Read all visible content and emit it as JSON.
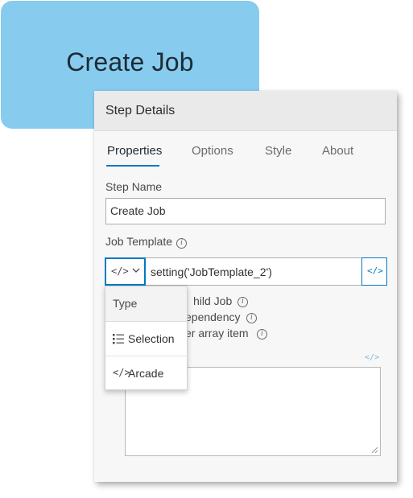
{
  "canvas": {
    "step_title": "Create Job"
  },
  "panel": {
    "title": "Step Details",
    "tabs": [
      {
        "label": "Properties",
        "active": true
      },
      {
        "label": "Options",
        "active": false
      },
      {
        "label": "Style",
        "active": false
      },
      {
        "label": "About",
        "active": false
      }
    ],
    "step_name": {
      "label": "Step Name",
      "value": "Create Job"
    },
    "job_template": {
      "label": "Job Template",
      "type_icon": "code-brackets-icon",
      "value": "setting('JobTemplate_2')",
      "toggle_icon": "code-brackets-icon"
    },
    "checkboxes": [
      {
        "label_visible": "hild Job",
        "checked": false
      },
      {
        "label_visible": "ependency",
        "checked": false
      },
      {
        "label_visible": "er array item",
        "checked": false
      }
    ],
    "textarea_icon": "code-brackets-icon",
    "colors": {
      "accent": "#007ac2",
      "node": "#87ccee"
    }
  },
  "dropdown": {
    "header": "Type",
    "items": [
      {
        "label": "Selection",
        "icon": "list-icon"
      },
      {
        "label": "Arcade",
        "icon": "code-brackets-icon"
      }
    ]
  }
}
